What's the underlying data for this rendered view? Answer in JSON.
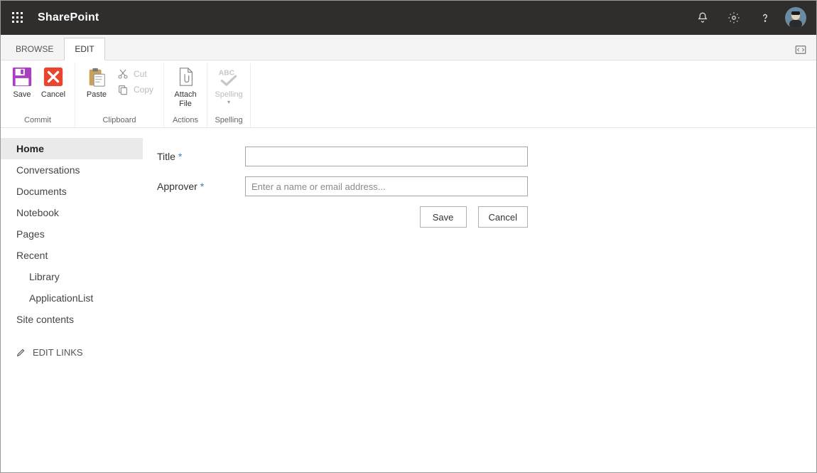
{
  "brand": "SharePoint",
  "tabs": {
    "browse": "BROWSE",
    "edit": "EDIT"
  },
  "ribbon": {
    "commit": {
      "label": "Commit",
      "save": "Save",
      "cancel": "Cancel"
    },
    "clipboard": {
      "label": "Clipboard",
      "paste": "Paste",
      "cut": "Cut",
      "copy": "Copy"
    },
    "actions": {
      "label": "Actions",
      "attach": "Attach\nFile"
    },
    "spelling": {
      "label": "Spelling",
      "btn": "Spelling"
    }
  },
  "sidebar": {
    "items": [
      {
        "label": "Home"
      },
      {
        "label": "Conversations"
      },
      {
        "label": "Documents"
      },
      {
        "label": "Notebook"
      },
      {
        "label": "Pages"
      },
      {
        "label": "Recent"
      }
    ],
    "recent_children": [
      {
        "label": "Library"
      },
      {
        "label": "ApplicationList"
      }
    ],
    "site_contents": "Site contents",
    "edit_links": "EDIT LINKS"
  },
  "form": {
    "title_label": "Title",
    "approver_label": "Approver",
    "approver_placeholder": "Enter a name or email address...",
    "save": "Save",
    "cancel": "Cancel"
  }
}
